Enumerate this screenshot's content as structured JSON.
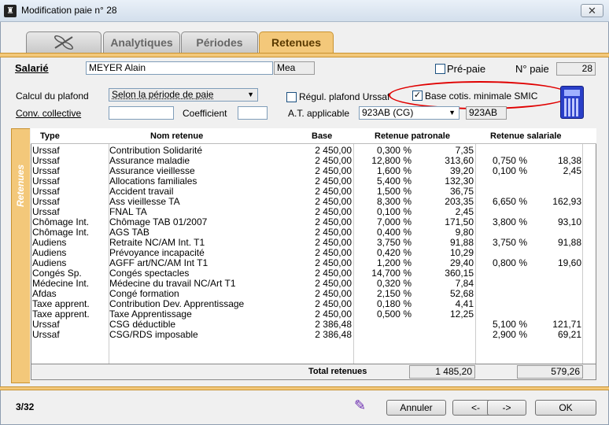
{
  "window": {
    "title": "Modification paie n° 28",
    "close_glyph": "✕"
  },
  "tabs": [
    {
      "label": ""
    },
    {
      "label": "Analytiques"
    },
    {
      "label": "Périodes"
    },
    {
      "label": "Retenues"
    }
  ],
  "form": {
    "salarie_label": "Salarié",
    "salarie_name": "MEYER Alain",
    "salarie_abbr": "Mea",
    "prepaie_label": "Pré-paie",
    "npaie_label": "N° paie",
    "npaie_value": "28",
    "plafond_label": "Calcul du plafond",
    "plafond_value": "Selon la période de paie",
    "regul_label": "Régul. plafond Urssaf",
    "base_label": "Base cotis. minimale SMIC",
    "base_checked": "✓",
    "conv_label": "Conv. collective",
    "conv_value": "",
    "coef_label": "Coefficient",
    "coef_value": "",
    "at_label": "A.T. applicable",
    "at_value": "923AB (CG)",
    "at_code": "923AB"
  },
  "side_label": "Retenues",
  "table": {
    "headers": {
      "type": "Type",
      "nom": "Nom retenue",
      "base": "Base",
      "pat": "Retenue patronale",
      "sal": "Retenue salariale"
    },
    "rows": [
      {
        "type": "Urssaf",
        "nom": "Contribution Solidarité",
        "base": "2 450,00",
        "pct1": "0,300 %",
        "amt1": "7,35",
        "pct2": "",
        "amt2": ""
      },
      {
        "type": "Urssaf",
        "nom": "Assurance maladie",
        "base": "2 450,00",
        "pct1": "12,800 %",
        "amt1": "313,60",
        "pct2": "0,750 %",
        "amt2": "18,38"
      },
      {
        "type": "Urssaf",
        "nom": "Assurance vieillesse",
        "base": "2 450,00",
        "pct1": "1,600 %",
        "amt1": "39,20",
        "pct2": "0,100 %",
        "amt2": "2,45"
      },
      {
        "type": "Urssaf",
        "nom": "Allocations familiales",
        "base": "2 450,00",
        "pct1": "5,400 %",
        "amt1": "132,30",
        "pct2": "",
        "amt2": ""
      },
      {
        "type": "Urssaf",
        "nom": "Accident travail",
        "base": "2 450,00",
        "pct1": "1,500 %",
        "amt1": "36,75",
        "pct2": "",
        "amt2": ""
      },
      {
        "type": "Urssaf",
        "nom": "Ass vieillesse TA",
        "base": "2 450,00",
        "pct1": "8,300 %",
        "amt1": "203,35",
        "pct2": "6,650 %",
        "amt2": "162,93"
      },
      {
        "type": "Urssaf",
        "nom": "FNAL TA",
        "base": "2 450,00",
        "pct1": "0,100 %",
        "amt1": "2,45",
        "pct2": "",
        "amt2": ""
      },
      {
        "type": "Chômage Int.",
        "nom": "Chômage TAB 01/2007",
        "base": "2 450,00",
        "pct1": "7,000 %",
        "amt1": "171,50",
        "pct2": "3,800 %",
        "amt2": "93,10"
      },
      {
        "type": "Chômage Int.",
        "nom": "AGS TAB",
        "base": "2 450,00",
        "pct1": "0,400 %",
        "amt1": "9,80",
        "pct2": "",
        "amt2": ""
      },
      {
        "type": "Audiens",
        "nom": "Retraite NC/AM Int. T1",
        "base": "2 450,00",
        "pct1": "3,750 %",
        "amt1": "91,88",
        "pct2": "3,750 %",
        "amt2": "91,88"
      },
      {
        "type": "Audiens",
        "nom": "Prévoyance incapacité",
        "base": "2 450,00",
        "pct1": "0,420 %",
        "amt1": "10,29",
        "pct2": "",
        "amt2": ""
      },
      {
        "type": "Audiens",
        "nom": "AGFF art/NC/AM Int T1",
        "base": "2 450,00",
        "pct1": "1,200 %",
        "amt1": "29,40",
        "pct2": "0,800 %",
        "amt2": "19,60"
      },
      {
        "type": "Congés Sp.",
        "nom": "Congés spectacles",
        "base": "2 450,00",
        "pct1": "14,700 %",
        "amt1": "360,15",
        "pct2": "",
        "amt2": ""
      },
      {
        "type": "Médecine Int.",
        "nom": "Médecine du travail NC/Art T1",
        "base": "2 450,00",
        "pct1": "0,320 %",
        "amt1": "7,84",
        "pct2": "",
        "amt2": ""
      },
      {
        "type": "Afdas",
        "nom": "Congé formation",
        "base": "2 450,00",
        "pct1": "2,150 %",
        "amt1": "52,68",
        "pct2": "",
        "amt2": ""
      },
      {
        "type": "Taxe apprent.",
        "nom": "Contribution Dev. Apprentissage",
        "base": "2 450,00",
        "pct1": "0,180 %",
        "amt1": "4,41",
        "pct2": "",
        "amt2": ""
      },
      {
        "type": "Taxe apprent.",
        "nom": "Taxe Apprentissage",
        "base": "2 450,00",
        "pct1": "0,500 %",
        "amt1": "12,25",
        "pct2": "",
        "amt2": ""
      },
      {
        "type": "Urssaf",
        "nom": "CSG déductible",
        "base": "2 386,48",
        "pct1": "",
        "amt1": "",
        "pct2": "5,100 %",
        "amt2": "121,71"
      },
      {
        "type": "Urssaf",
        "nom": "CSG/RDS imposable",
        "base": "2 386,48",
        "pct1": "",
        "amt1": "",
        "pct2": "2,900 %",
        "amt2": "69,21"
      }
    ],
    "total_label": "Total retenues",
    "total_pat": "1 485,20",
    "total_sal": "579,26"
  },
  "footer": {
    "count": "3/32",
    "annuler": "Annuler",
    "prev": "<-",
    "next": "->",
    "ok": "OK"
  }
}
